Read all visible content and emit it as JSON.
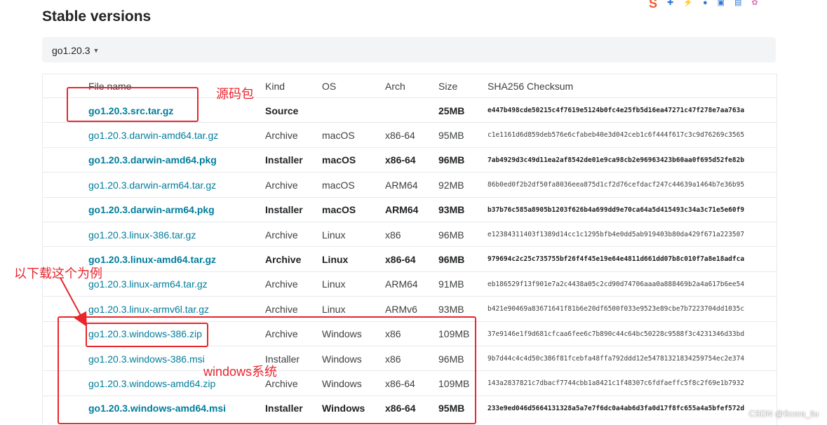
{
  "page": {
    "title": "Stable versions"
  },
  "toolbar": {
    "icons": [
      "csdn-logo-icon",
      "plus-icon",
      "wand-icon",
      "mic-icon",
      "image-icon",
      "shirt-icon",
      "flower-icon"
    ],
    "logo_text": "S"
  },
  "version_selector": {
    "value": "go1.20.3"
  },
  "table": {
    "headers": {
      "file": "File name",
      "kind": "Kind",
      "os": "OS",
      "arch": "Arch",
      "size": "Size",
      "sha": "SHA256 Checksum"
    },
    "rows": [
      {
        "file": "go1.20.3.src.tar.gz",
        "kind": "Source",
        "os": "",
        "arch": "",
        "size": "25MB",
        "sha": "e447b498cde50215c4f7619e5124b0fc4e25fb5d16ea47271c47f278e7aa763a",
        "bold": true
      },
      {
        "file": "go1.20.3.darwin-amd64.tar.gz",
        "kind": "Archive",
        "os": "macOS",
        "arch": "x86-64",
        "size": "95MB",
        "sha": "c1e1161d6d859deb576e6cfabeb40e3d042ceb1c6f444f617c3c9d76269c3565",
        "bold": false
      },
      {
        "file": "go1.20.3.darwin-amd64.pkg",
        "kind": "Installer",
        "os": "macOS",
        "arch": "x86-64",
        "size": "96MB",
        "sha": "7ab4929d3c49d11ea2af8542de01e9ca98cb2e96963423b60aa0f695d52fe82b",
        "bold": true
      },
      {
        "file": "go1.20.3.darwin-arm64.tar.gz",
        "kind": "Archive",
        "os": "macOS",
        "arch": "ARM64",
        "size": "92MB",
        "sha": "86b0ed0f2b2df50fa8036eea875d1cf2d76cefdacf247c44639a1464b7e36b95",
        "bold": false
      },
      {
        "file": "go1.20.3.darwin-arm64.pkg",
        "kind": "Installer",
        "os": "macOS",
        "arch": "ARM64",
        "size": "93MB",
        "sha": "b37b76c585a8905b1203f626b4a699dd9e70ca64a5d415493c34a3c71e5e60f9",
        "bold": true
      },
      {
        "file": "go1.20.3.linux-386.tar.gz",
        "kind": "Archive",
        "os": "Linux",
        "arch": "x86",
        "size": "96MB",
        "sha": "e12384311403f1389d14cc1c1295bfb4e0dd5ab919403b80da429f671a223507",
        "bold": false
      },
      {
        "file": "go1.20.3.linux-amd64.tar.gz",
        "kind": "Archive",
        "os": "Linux",
        "arch": "x86-64",
        "size": "96MB",
        "sha": "979694c2c25c735755bf26f4f45e19e64e4811d661dd07b8c010f7a8e18adfca",
        "bold": true
      },
      {
        "file": "go1.20.3.linux-arm64.tar.gz",
        "kind": "Archive",
        "os": "Linux",
        "arch": "ARM64",
        "size": "91MB",
        "sha": "eb186529f13f901e7a2c4438a05c2cd90d74706aaa0a888469b2a4a617b6ee54",
        "bold": false
      },
      {
        "file": "go1.20.3.linux-armv6l.tar.gz",
        "kind": "Archive",
        "os": "Linux",
        "arch": "ARMv6",
        "size": "93MB",
        "sha": "b421e90469a83671641f81b6e20df6500f033e9523e89cbe7b7223704dd1035c",
        "bold": false
      },
      {
        "file": "go1.20.3.windows-386.zip",
        "kind": "Archive",
        "os": "Windows",
        "arch": "x86",
        "size": "109MB",
        "sha": "37e9146e1f9d681cfcaa6fee6c7b890c44c64bc50228c9588f3c4231346d33bd",
        "bold": false
      },
      {
        "file": "go1.20.3.windows-386.msi",
        "kind": "Installer",
        "os": "Windows",
        "arch": "x86",
        "size": "96MB",
        "sha": "9b7d44c4c4d50c386f81fcebfa48ffa792ddd12e54781321834259754ec2e374",
        "bold": false
      },
      {
        "file": "go1.20.3.windows-amd64.zip",
        "kind": "Archive",
        "os": "Windows",
        "arch": "x86-64",
        "size": "109MB",
        "sha": "143a2837821c7dbacf7744cbb1a8421c1f48307c6fdfaeffc5f8c2f69e1b7932",
        "bold": false
      },
      {
        "file": "go1.20.3.windows-amd64.msi",
        "kind": "Installer",
        "os": "Windows",
        "arch": "x86-64",
        "size": "95MB",
        "sha": "233e9ed046d5664131328a5a7e7f6dc0a4ab6d3fa0d17f8fc655a4a5bfef572d",
        "bold": true
      }
    ]
  },
  "annotations": {
    "source_note": "源码包",
    "download_note": "以下载这个为例",
    "windows_note": "windows系统",
    "color": "#e8262d"
  },
  "watermark": "CSDN @Scora_liu"
}
